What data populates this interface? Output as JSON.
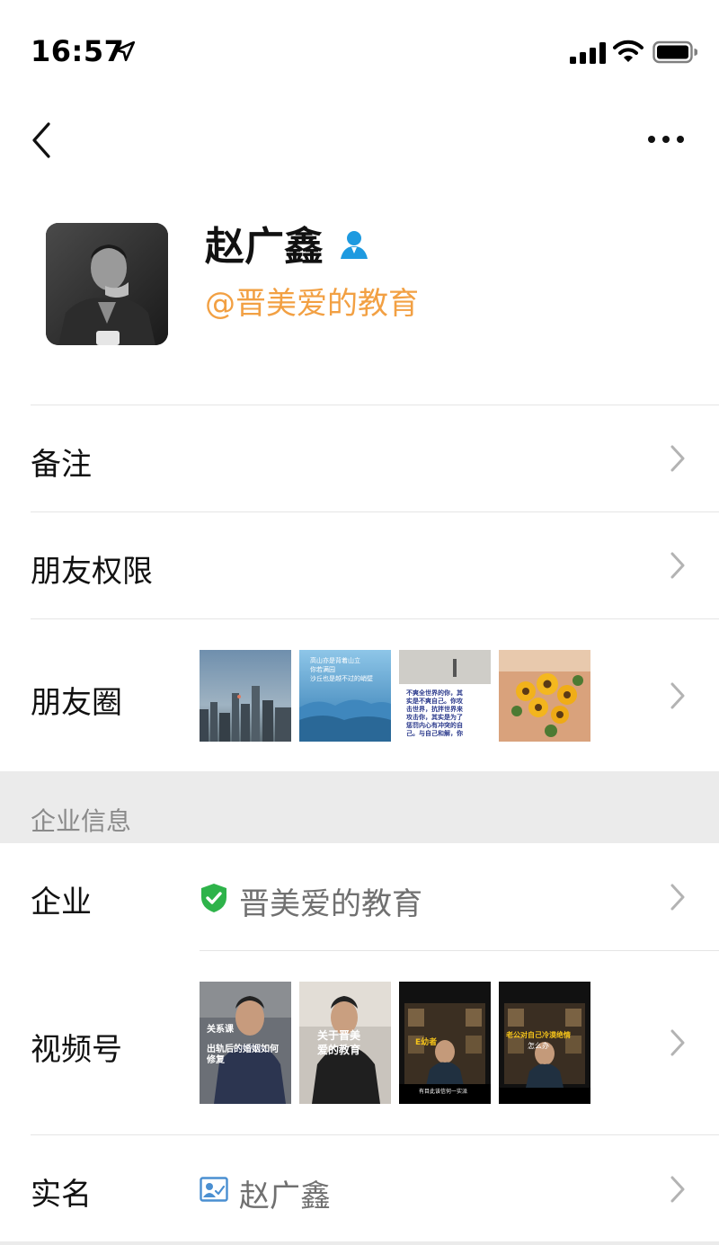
{
  "status": {
    "time": "16:57"
  },
  "profile": {
    "name": "赵广鑫",
    "handle": "@晋美爱的教育"
  },
  "rows": {
    "remark": "备注",
    "permissions": "朋友权限",
    "moments": "朋友圈"
  },
  "moments_thumbs": [
    {
      "alt": "city-skyline",
      "text_lines": []
    },
    {
      "alt": "mountains-quote",
      "text_lines": [
        "高山亦是背着山立",
        "你若满园",
        "沙丘也是越不过的峭壁"
      ]
    },
    {
      "alt": "quote-card",
      "text_lines": [
        "不爽全世界的你，其",
        "实是不爽自己。你攻",
        "击世界，抗拌世界来",
        "攻击你，其实是为了",
        "惩罚内心有冲突的自",
        "己。与自己和解，你"
      ]
    },
    {
      "alt": "sunflower-bouquet",
      "text_lines": []
    }
  ],
  "enterprise": {
    "section_title": "企业信息",
    "label": "企业",
    "company": "晋美爱的教育"
  },
  "channels": {
    "label": "视频号",
    "videos": [
      {
        "alt": "video-1",
        "text_lines": [
          "关系课",
          "出轨后的婚姻如何",
          "修复"
        ]
      },
      {
        "alt": "video-2",
        "text_lines": [
          "关于晋美",
          "爱的教育"
        ]
      },
      {
        "alt": "video-3",
        "text_lines": [
          "E幼者",
          "有目此该信何一实派"
        ]
      },
      {
        "alt": "video-4",
        "text_lines": [
          "老公对自己冷漠绝情",
          "怎么办"
        ]
      }
    ]
  },
  "realname": {
    "label": "实名",
    "value": "赵广鑫"
  },
  "colors": {
    "handle": "#f2a043",
    "verified": "#2eb34a",
    "badge": "#1e9ae0",
    "section_bg": "#ebebeb"
  },
  "icons": [
    "location-arrow-icon",
    "signal-icon",
    "wifi-icon",
    "battery-icon",
    "back-arrow-icon",
    "more-dots-icon",
    "user-badge-icon",
    "chevron-right-icon",
    "verified-shield-icon",
    "id-card-icon"
  ]
}
